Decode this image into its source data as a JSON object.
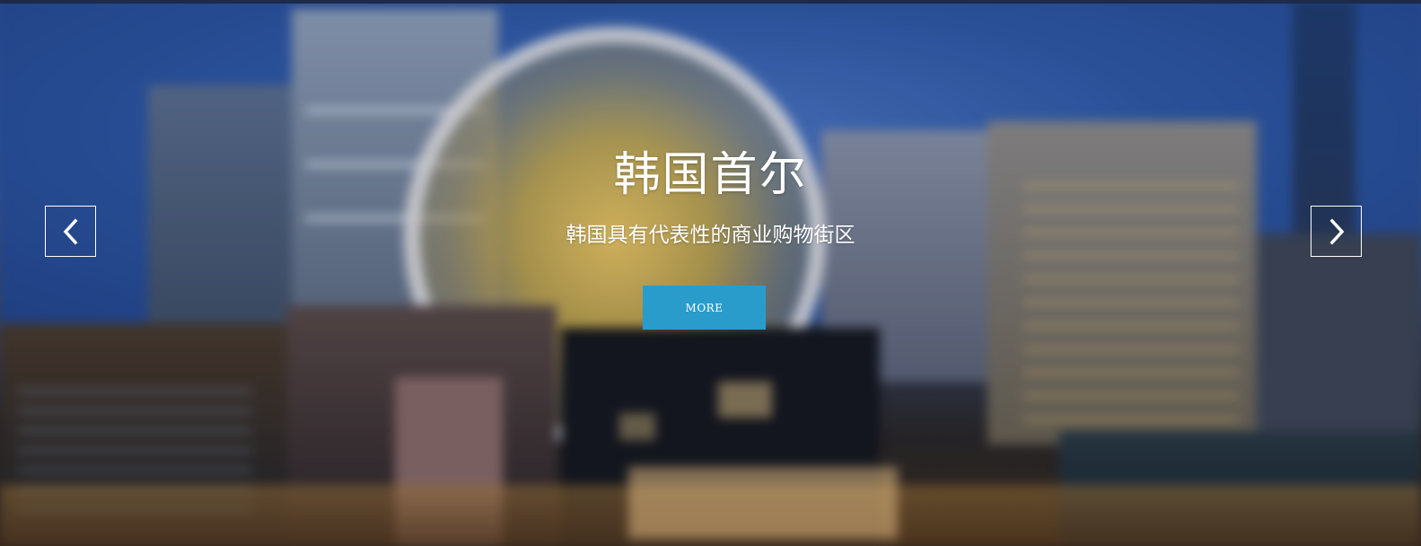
{
  "slide": {
    "title": "韩国首尔",
    "subtitle": "韩国具有代表性的商业购物街区",
    "button_label": "MORE"
  },
  "controls": {
    "prev_icon": "chevron-left-icon",
    "next_icon": "chevron-right-icon"
  },
  "colors": {
    "accent": "#2a9ccc",
    "text": "#ffffff"
  }
}
